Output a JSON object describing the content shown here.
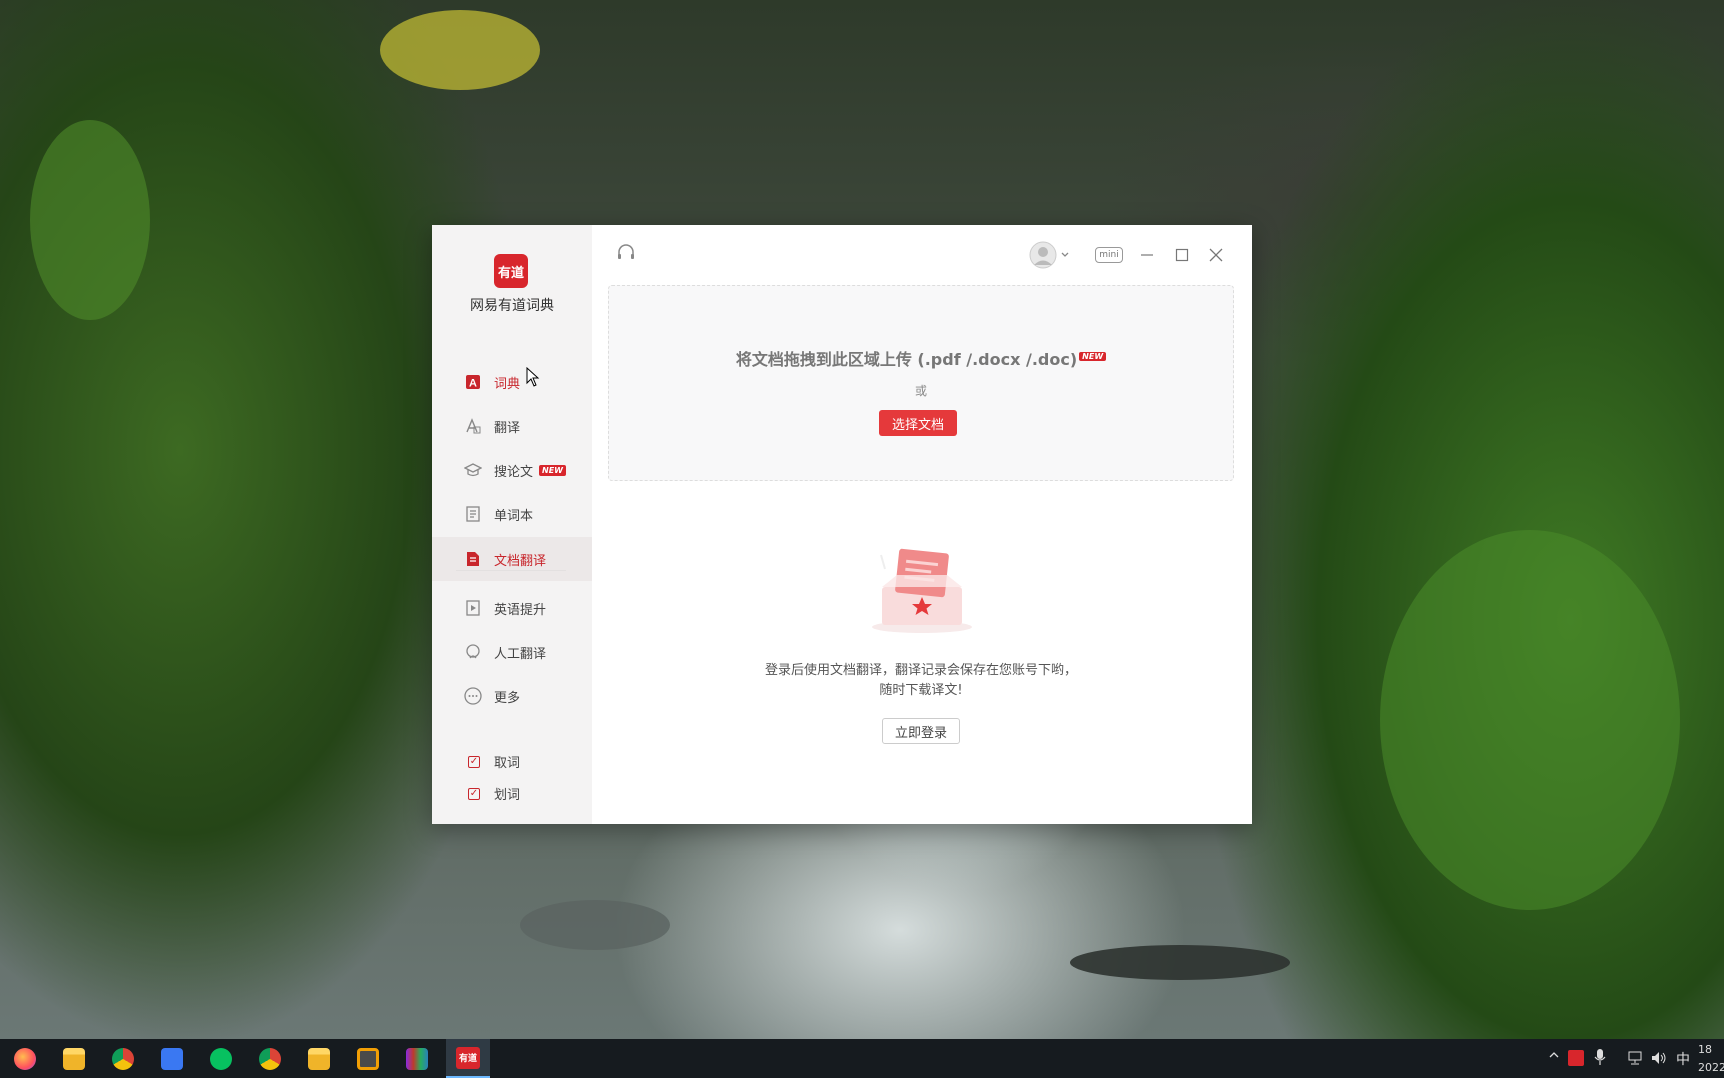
{
  "app": {
    "logo_text": "有道",
    "name": "网易有道词典"
  },
  "sidebar": {
    "items": [
      {
        "label": "词典",
        "icon": "dictionary-icon"
      },
      {
        "label": "翻译",
        "icon": "translate-icon"
      },
      {
        "label": "搜论文",
        "icon": "graduation-cap-icon",
        "badge": "NEW"
      },
      {
        "label": "单词本",
        "icon": "wordbook-icon"
      },
      {
        "label": "文档翻译",
        "icon": "document-icon"
      },
      {
        "label": "英语提升",
        "icon": "play-book-icon"
      },
      {
        "label": "人工翻译",
        "icon": "human-translate-icon"
      },
      {
        "label": "更多",
        "icon": "more-icon"
      }
    ],
    "checks": [
      {
        "label": "取词",
        "checked": true
      },
      {
        "label": "划词",
        "checked": true
      }
    ]
  },
  "topbar": {
    "mini_label": "mini"
  },
  "dropzone": {
    "title": "将文档拖拽到此区域上传 (.pdf /.docx /.doc)",
    "badge": "NEW",
    "or": "或",
    "choose_button": "选择文档"
  },
  "empty_state": {
    "line1": "登录后使用文档翻译，翻译记录会保存在您账号下哟，",
    "line2": "随时下载译文!",
    "login_button": "立即登录"
  },
  "taskbar": {
    "active_app_label": "有道",
    "ime": "中",
    "clock_time": "18",
    "clock_date": "2022"
  },
  "colors": {
    "brand_red": "#d8262c",
    "button_red": "#e5393b"
  }
}
